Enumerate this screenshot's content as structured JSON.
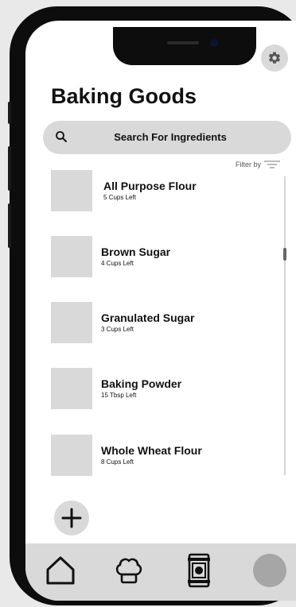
{
  "header": {
    "title": "Baking Goods"
  },
  "search": {
    "placeholder": "Search For Ingredients"
  },
  "filter": {
    "label": "Filter by"
  },
  "ingredients": [
    {
      "name": "All Purpose Flour",
      "quantity": "5 Cups Left"
    },
    {
      "name": "Brown Sugar",
      "quantity": "4 Cups Left"
    },
    {
      "name": "Granulated Sugar",
      "quantity": "3 Cups Left"
    },
    {
      "name": "Baking Powder",
      "quantity": "15 Tbsp Left"
    },
    {
      "name": "Whole Wheat Flour",
      "quantity": "8 Cups Left"
    }
  ],
  "icons": {
    "settings": "gear-icon",
    "search": "search-icon",
    "filter": "filter-icon",
    "add": "plus-icon",
    "nav_home": "home-icon",
    "nav_recipes": "chef-hat-icon",
    "nav_pantry": "jar-icon",
    "nav_profile": "avatar"
  },
  "colors": {
    "surface": "#d9d9d9",
    "text": "#111111",
    "avatar": "#a6a6a6"
  }
}
